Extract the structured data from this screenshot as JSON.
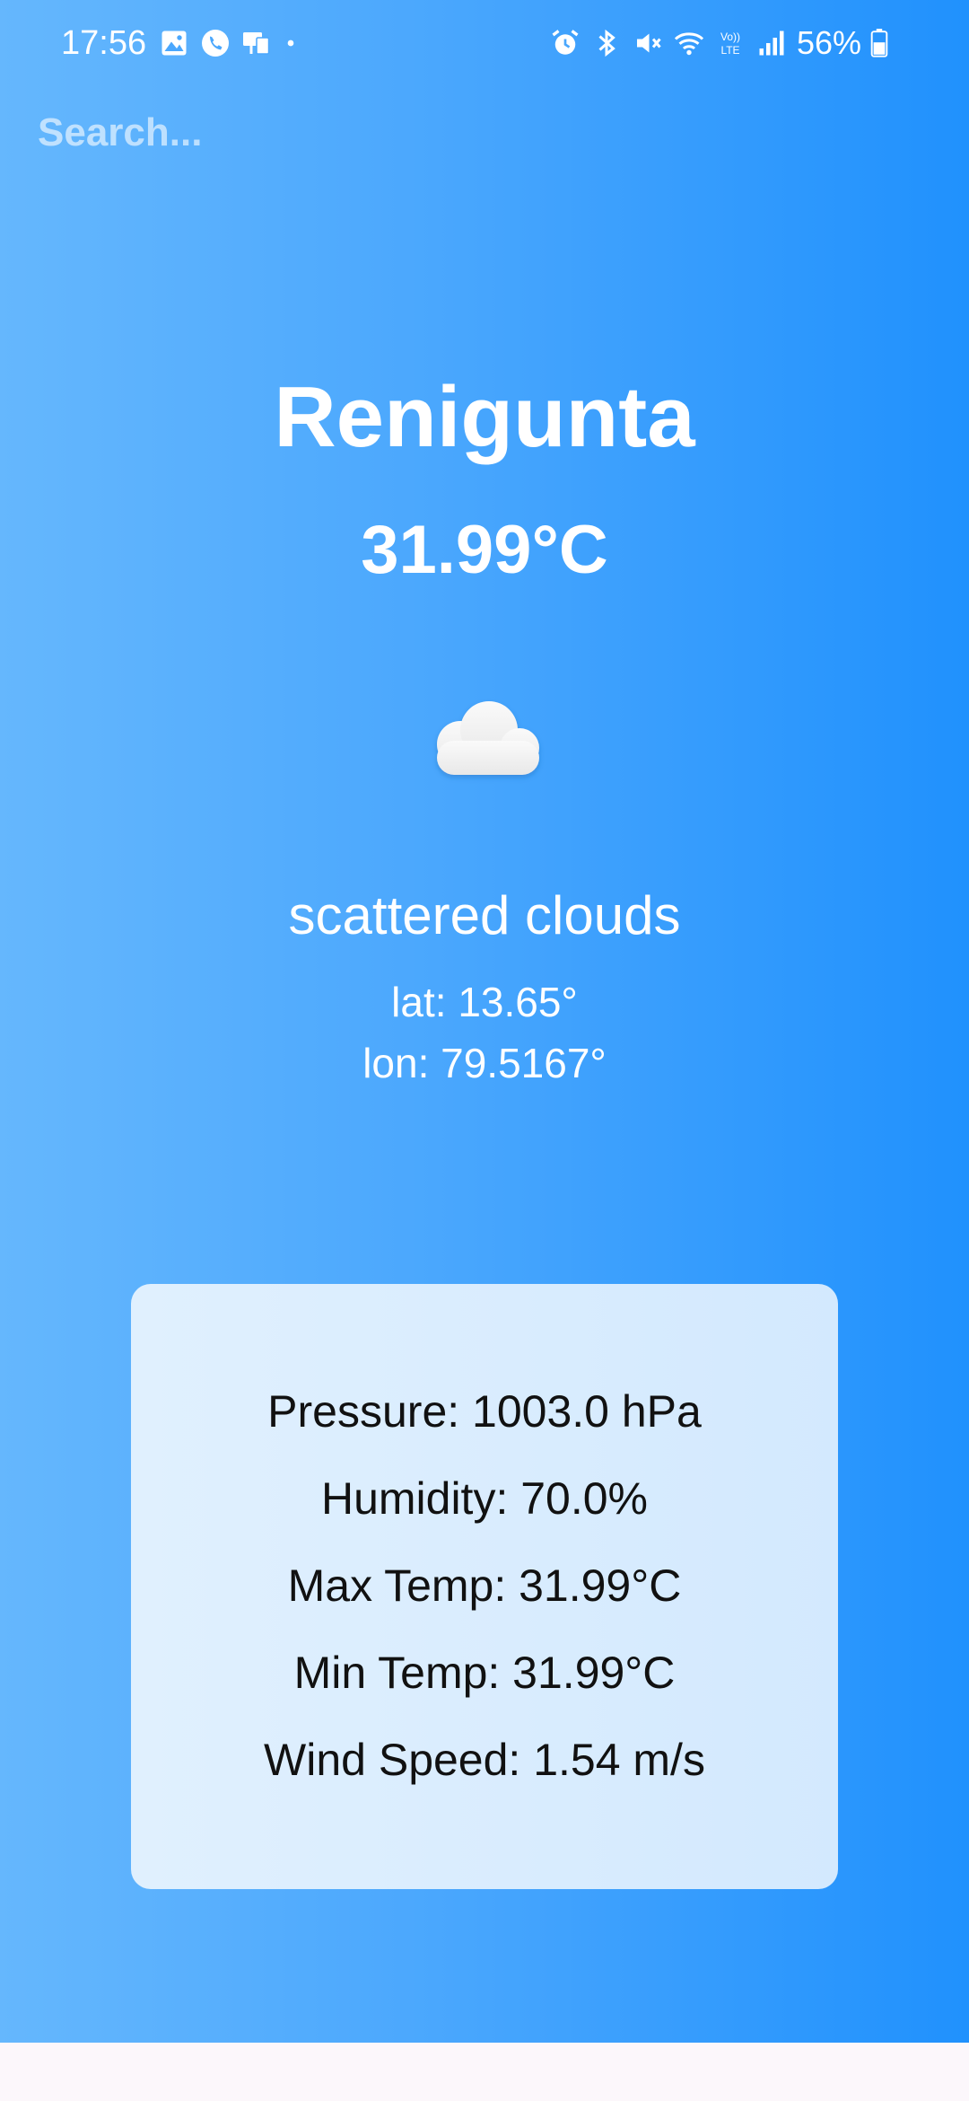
{
  "status_bar": {
    "time": "17:56",
    "battery": "56%",
    "left_icons": [
      "gallery-icon",
      "call-icon",
      "cast-icon",
      "dot-icon"
    ],
    "right_icons": [
      "alarm-icon",
      "bluetooth-icon",
      "mute-icon",
      "wifi-icon",
      "volte-icon",
      "signal-icon",
      "battery-icon"
    ]
  },
  "search": {
    "placeholder": "Search..."
  },
  "weather": {
    "city": "Renigunta",
    "temperature": "31.99°C",
    "icon": "cloud-icon",
    "description": "scattered clouds",
    "lat": "lat: 13.65°",
    "lon": "lon: 79.5167°"
  },
  "details": [
    "Pressure: 1003.0 hPa",
    "Humidity: 70.0%",
    "Max Temp: 31.99°C",
    "Min Temp: 31.99°C",
    "Wind Speed: 1.54 m/s"
  ],
  "colors": {
    "gradient_start": "#65b7fd",
    "gradient_end": "#2091fd",
    "card_background": "#dbedfe",
    "text_primary": "#ffffff",
    "card_text": "#111111"
  }
}
